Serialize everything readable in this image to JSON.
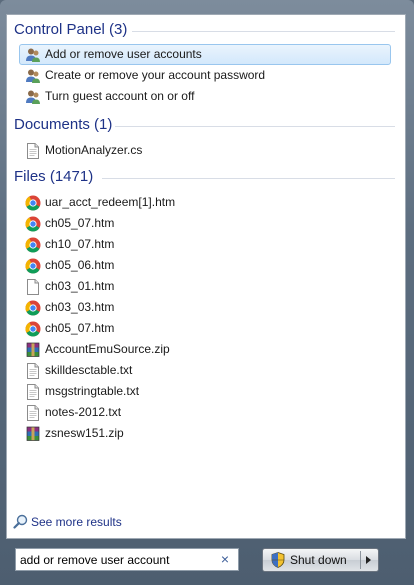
{
  "sections": {
    "control_panel": {
      "title": "Control Panel (3)",
      "items": [
        {
          "label": "Add or remove user accounts",
          "icon": "user-accounts-icon"
        },
        {
          "label": "Create or remove your account password",
          "icon": "user-accounts-icon"
        },
        {
          "label": "Turn guest account on or off",
          "icon": "user-accounts-icon"
        }
      ]
    },
    "documents": {
      "title": "Documents (1)",
      "items": [
        {
          "label": "MotionAnalyzer.cs",
          "icon": "text-file-icon"
        }
      ]
    },
    "files": {
      "title": "Files (1471)",
      "items": [
        {
          "label": "uar_acct_redeem[1].htm",
          "icon": "chrome-icon"
        },
        {
          "label": "ch05_07.htm",
          "icon": "chrome-icon"
        },
        {
          "label": "ch10_07.htm",
          "icon": "chrome-icon"
        },
        {
          "label": "ch05_06.htm",
          "icon": "chrome-icon"
        },
        {
          "label": "ch03_01.htm",
          "icon": "blank-file-icon"
        },
        {
          "label": "ch03_03.htm",
          "icon": "chrome-icon"
        },
        {
          "label": "ch05_07.htm",
          "icon": "chrome-icon"
        },
        {
          "label": "AccountEmuSource.zip",
          "icon": "winrar-archive-icon"
        },
        {
          "label": "skilldesctable.txt",
          "icon": "text-file-icon"
        },
        {
          "label": "msgstringtable.txt",
          "icon": "text-file-icon"
        },
        {
          "label": "notes-2012.txt",
          "icon": "text-file-icon"
        },
        {
          "label": "zsnesw151.zip",
          "icon": "winrar-archive-icon"
        }
      ]
    }
  },
  "see_more": {
    "label": "See more results",
    "icon": "magnifier-icon"
  },
  "search": {
    "value": "add or remove user account",
    "clear_glyph": "×"
  },
  "shutdown": {
    "label": "Shut down",
    "icon": "uac-shield-icon"
  },
  "colors": {
    "heading": "#1e3287",
    "selection_border": "#99c6ee"
  }
}
